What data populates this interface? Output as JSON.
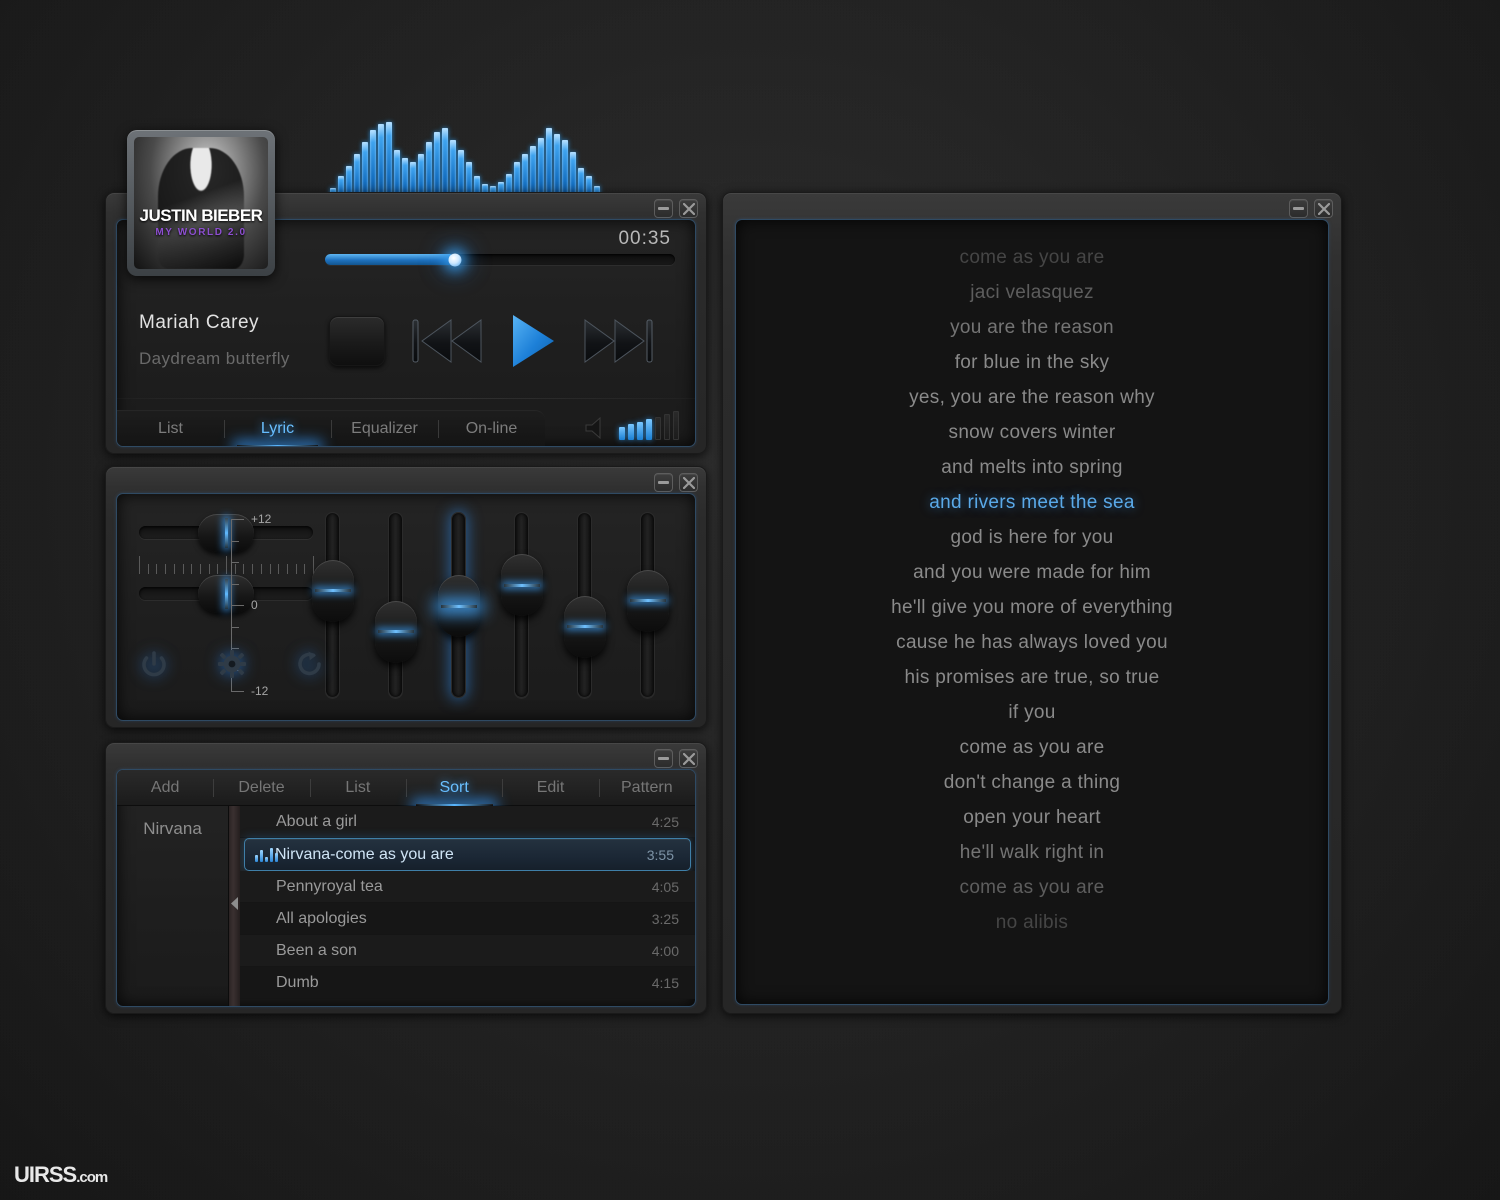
{
  "app": {
    "watermark": "UIRSS",
    "watermark_suffix": ".com"
  },
  "window_controls": {
    "minimize": "minimize-icon",
    "close": "close-icon"
  },
  "visualizer": {
    "name": "spectrum-visualizer",
    "bars": [
      10,
      22,
      32,
      44,
      56,
      68,
      74,
      76,
      48,
      40,
      36,
      44,
      56,
      66,
      70,
      58,
      48,
      36,
      22,
      14,
      12,
      16,
      24,
      36,
      44,
      52,
      60,
      70,
      64,
      58,
      46,
      30,
      22,
      12
    ]
  },
  "album": {
    "artist_line": "JUSTIN BIEBER",
    "title_line": "MY WORLD 2.0"
  },
  "player": {
    "time": "00:35",
    "progress_percent": 37,
    "track_title": "Mariah  Carey",
    "track_subtitle": "Daydream  butterfly",
    "controls": {
      "stop": "stop-button",
      "previous": "previous-button",
      "play": "play-button",
      "next": "next-button"
    },
    "tabs": [
      {
        "label": "List",
        "active": false
      },
      {
        "label": "Lyric",
        "active": true
      },
      {
        "label": "Equalizer",
        "active": false
      },
      {
        "label": "On-line",
        "active": false
      }
    ],
    "volume": {
      "level": 4,
      "total": 7
    }
  },
  "equalizer": {
    "scale_top": "+12",
    "scale_mid": "0",
    "scale_bottom": "-12",
    "horizontal_sliders": [
      {
        "name": "balance-slider",
        "value_percent": 50
      },
      {
        "name": "preamp-slider",
        "value_percent": 50
      }
    ],
    "band_values": [
      3,
      -5,
      0,
      4,
      -4,
      1
    ],
    "icons": [
      {
        "name": "power-icon"
      },
      {
        "name": "gear-icon"
      },
      {
        "name": "reset-icon"
      }
    ]
  },
  "playlist": {
    "buttons": [
      {
        "label": "Add",
        "active": false
      },
      {
        "label": "Delete",
        "active": false
      },
      {
        "label": "List",
        "active": false
      },
      {
        "label": "Sort",
        "active": true
      },
      {
        "label": "Edit",
        "active": false
      },
      {
        "label": "Pattern",
        "active": false
      }
    ],
    "category": "Nirvana",
    "tracks": [
      {
        "name": "About a girl",
        "time": "4:25",
        "playing": false
      },
      {
        "name": "Nirvana-come as you are",
        "time": "3:55",
        "playing": true
      },
      {
        "name": "Pennyroyal tea",
        "time": "4:05",
        "playing": false
      },
      {
        "name": "All apologies",
        "time": "3:25",
        "playing": false
      },
      {
        "name": "Been a son",
        "time": "4:00",
        "playing": false
      },
      {
        "name": "Dumb",
        "time": "4:15",
        "playing": false
      }
    ]
  },
  "lyrics": {
    "lines": [
      {
        "text": "come as you are",
        "current": false
      },
      {
        "text": "jaci velasquez",
        "current": false
      },
      {
        "text": "you are the reason",
        "current": false
      },
      {
        "text": "for blue in the sky",
        "current": false
      },
      {
        "text": "yes, you are the reason why",
        "current": false
      },
      {
        "text": "snow covers winter",
        "current": false
      },
      {
        "text": "and melts into spring",
        "current": false
      },
      {
        "text": "and rivers meet the sea",
        "current": true
      },
      {
        "text": "god is here for you",
        "current": false
      },
      {
        "text": "and you were made for him",
        "current": false
      },
      {
        "text": "he'll give you more of everything",
        "current": false
      },
      {
        "text": "cause he has always loved you",
        "current": false
      },
      {
        "text": "his promises are true, so true",
        "current": false
      },
      {
        "text": "if you",
        "current": false
      },
      {
        "text": "come as you are",
        "current": false
      },
      {
        "text": "don't change a thing",
        "current": false
      },
      {
        "text": "open your heart",
        "current": false
      },
      {
        "text": "he'll walk right in",
        "current": false
      },
      {
        "text": "come as you are",
        "current": false
      },
      {
        "text": "no alibis",
        "current": false
      }
    ]
  },
  "colors": {
    "accent": "#4aa3ef",
    "accent_glow": "#6bc0ff",
    "text_dim": "#8a8a8a",
    "purple": "#8d4fd0"
  }
}
